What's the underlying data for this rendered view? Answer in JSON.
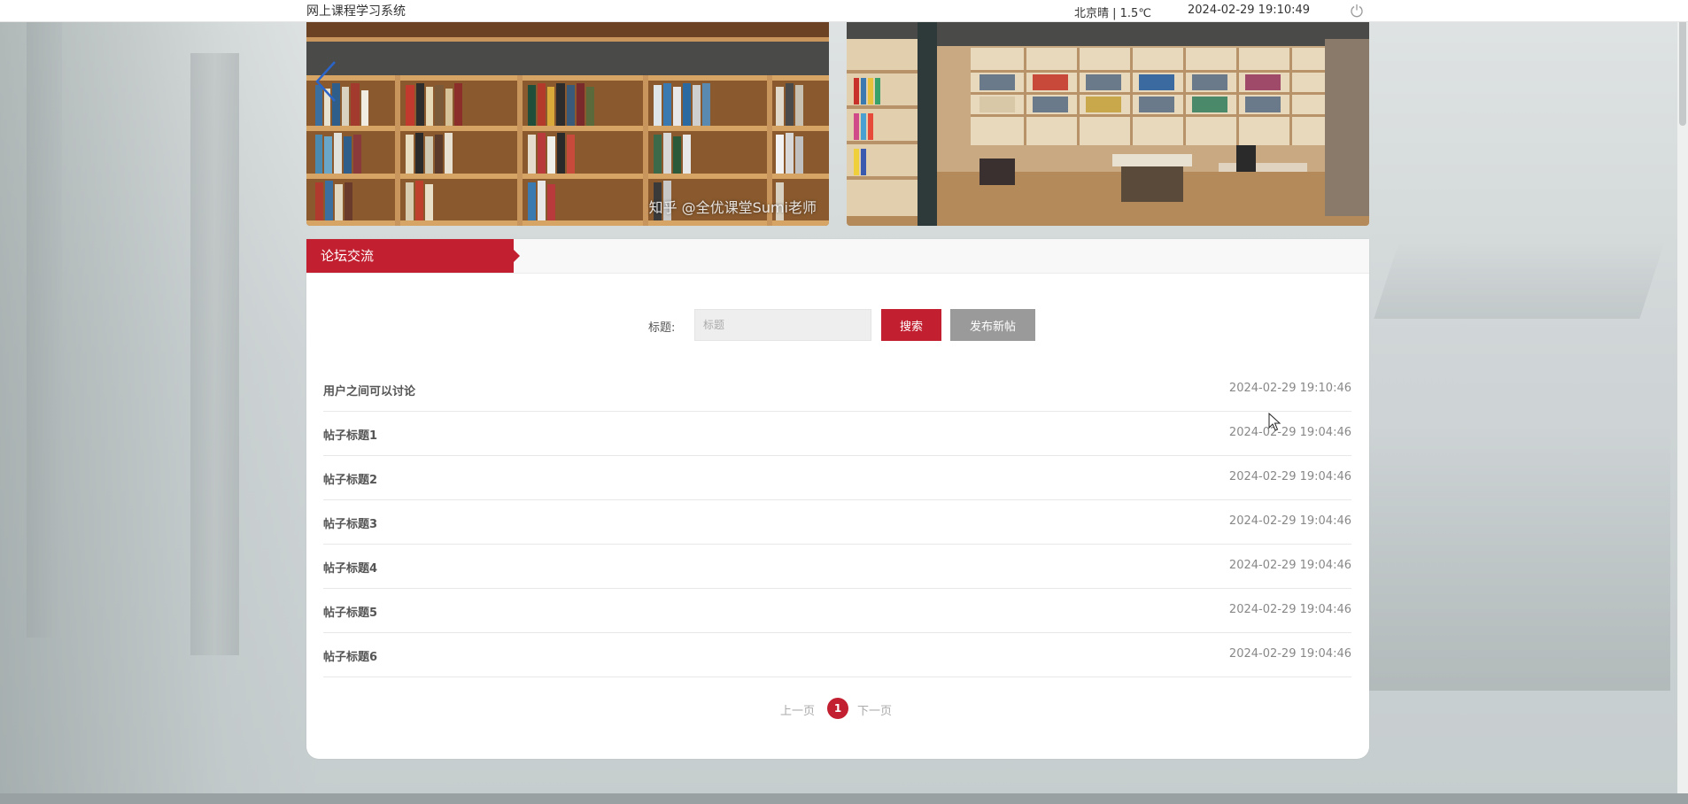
{
  "header": {
    "site_title": "网上课程学习系统",
    "weather": "北京晴 | 1.5℃",
    "datetime": "2024-02-29   19:10:49",
    "power_icon": "power-icon"
  },
  "banners": {
    "left_watermark": "知乎 @全优课堂Sumi老师",
    "arrow_left_icon": "chevron-left-icon",
    "arrow_right_icon": "chevron-right-icon"
  },
  "forum": {
    "tab_label": "论坛交流",
    "search_label": "标题:",
    "search_placeholder": "标题",
    "search_value": "",
    "search_button": "搜索",
    "new_post_button": "发布新帖",
    "posts": [
      {
        "title": "用户之间可以讨论",
        "time": "2024-02-29 19:10:46"
      },
      {
        "title": "帖子标题1",
        "time": "2024-02-29 19:04:46"
      },
      {
        "title": "帖子标题2",
        "time": "2024-02-29 19:04:46"
      },
      {
        "title": "帖子标题3",
        "time": "2024-02-29 19:04:46"
      },
      {
        "title": "帖子标题4",
        "time": "2024-02-29 19:04:46"
      },
      {
        "title": "帖子标题5",
        "time": "2024-02-29 19:04:46"
      },
      {
        "title": "帖子标题6",
        "time": "2024-02-29 19:04:46"
      }
    ],
    "pager": {
      "prev": "上一页",
      "current": "1",
      "next": "下一页"
    }
  },
  "colors": {
    "accent": "#c21f30",
    "secondary_button": "#9a9a9a"
  }
}
